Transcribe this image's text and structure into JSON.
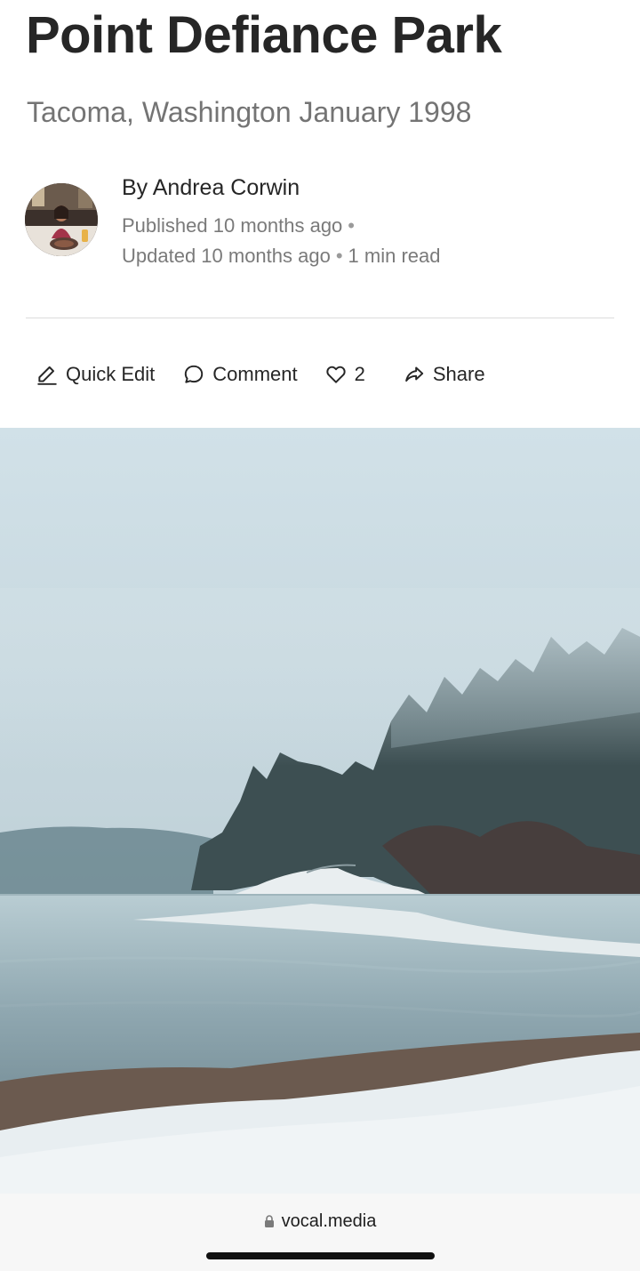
{
  "article": {
    "title": "Point Defiance Park",
    "subtitle": "Tacoma, Washington January 1998"
  },
  "author": {
    "byline": "By Andrea Corwin",
    "published": "Published 10 months ago",
    "updated": "Updated 10 months ago",
    "read_time": "1 min read",
    "separator": "•"
  },
  "actions": {
    "quick_edit": "Quick Edit",
    "comment": "Comment",
    "likes": "2",
    "share": "Share"
  },
  "browser": {
    "url": "vocal.media"
  },
  "icons": {
    "quick_edit": "pencil-icon",
    "comment": "comment-bubble-icon",
    "like": "heart-icon",
    "share": "share-arrow-icon",
    "lock": "lock-icon"
  },
  "colors": {
    "title": "#262626",
    "subtitle": "#747474",
    "meta": "#7a7a7a",
    "divider": "#dcdcdc"
  }
}
